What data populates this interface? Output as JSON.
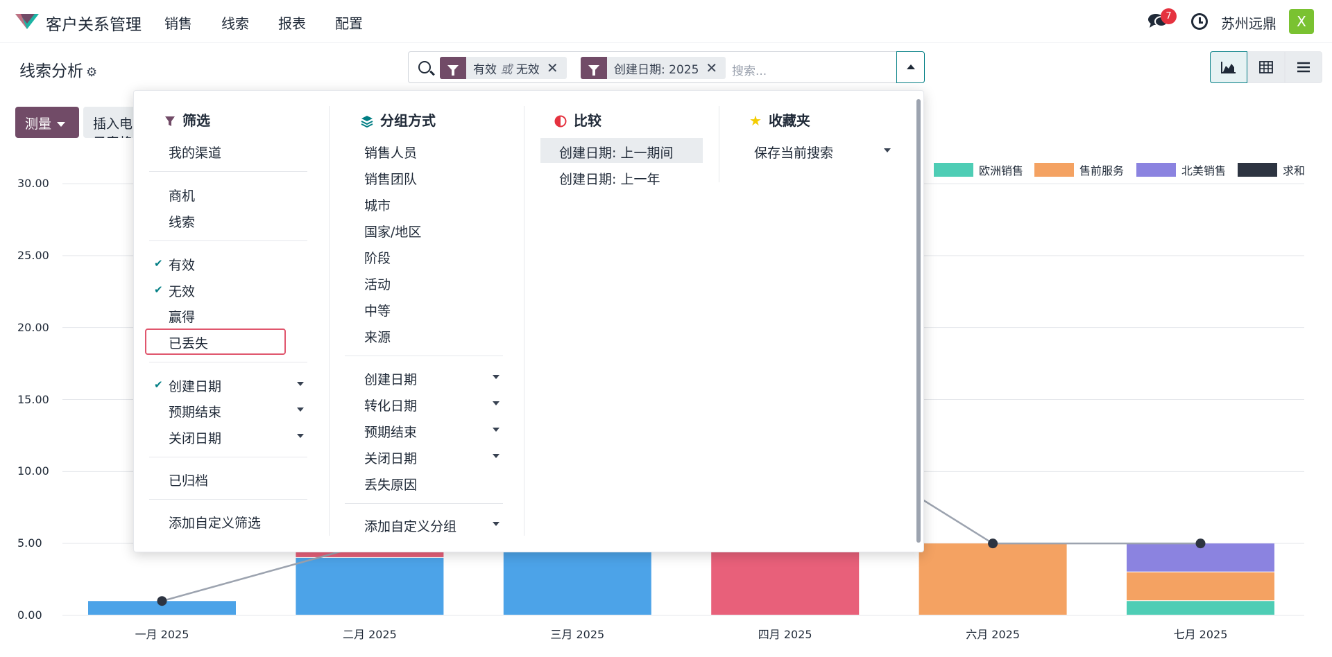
{
  "app": {
    "title": "客户关系管理",
    "menu": [
      "销售",
      "线索",
      "报表",
      "配置"
    ]
  },
  "topbar": {
    "notif_count": "7",
    "company": "苏州远鼎",
    "avatar_letter": "X"
  },
  "breadcrumb": {
    "title": "线索分析"
  },
  "search": {
    "facets": [
      {
        "value_a": "有效",
        "or": "或",
        "value_b": "无效"
      },
      {
        "value": "创建日期: 2025"
      }
    ],
    "placeholder": "搜索..."
  },
  "toolbar": {
    "measure": "测量",
    "insert": "插入电子表格"
  },
  "filters": {
    "header": "筛选",
    "items": [
      "我的渠道",
      "商机",
      "线索",
      "有效",
      "无效",
      "赢得",
      "已丢失",
      "创建日期",
      "预期结束",
      "关闭日期",
      "已归档",
      "添加自定义筛选"
    ]
  },
  "groupby": {
    "header": "分组方式",
    "items": [
      "销售人员",
      "销售团队",
      "城市",
      "国家/地区",
      "阶段",
      "活动",
      "中等",
      "来源",
      "创建日期",
      "转化日期",
      "预期结束",
      "关闭日期",
      "丢失原因",
      "添加自定义分组"
    ]
  },
  "compare": {
    "header": "比较",
    "items": [
      "创建日期: 上一期间",
      "创建日期: 上一年"
    ]
  },
  "favorites": {
    "header": "收藏夹",
    "items": [
      "保存当前搜索"
    ]
  },
  "colors": {
    "primary": "#714b67",
    "accent": "#017e84"
  },
  "chart_data": {
    "type": "bar",
    "categories": [
      "一月 2025",
      "二月 2025",
      "三月 2025",
      "四月 2025",
      "六月 2025",
      "七月 2025"
    ],
    "yticks": [
      "0.00",
      "5.00",
      "10.00",
      "15.00",
      "20.00",
      "25.00",
      "30.00"
    ],
    "ylim": [
      0,
      30
    ],
    "legend": [
      "欧洲销售",
      "售前服务",
      "北美销售",
      "求和"
    ],
    "series": [
      {
        "color": "#4ca3e8",
        "values": [
          1,
          4,
          10,
          0,
          0,
          0
        ]
      },
      {
        "color": "#e8607a",
        "values": [
          0,
          14,
          0,
          10,
          0,
          0
        ]
      },
      {
        "name": "欧洲销售",
        "color": "#4ecdb5",
        "values": [
          0,
          0,
          0,
          0,
          0,
          1
        ]
      },
      {
        "name": "售前服务",
        "color": "#f4a262",
        "values": [
          0,
          0,
          0,
          0,
          5,
          2
        ]
      },
      {
        "name": "北美销售",
        "color": "#8b83e0",
        "values": [
          0,
          0,
          0,
          0,
          0,
          2
        ]
      }
    ],
    "cumulative": {
      "name": "求和",
      "color": "#2d3441",
      "values": [
        1,
        5,
        10,
        14,
        5,
        5
      ]
    }
  }
}
